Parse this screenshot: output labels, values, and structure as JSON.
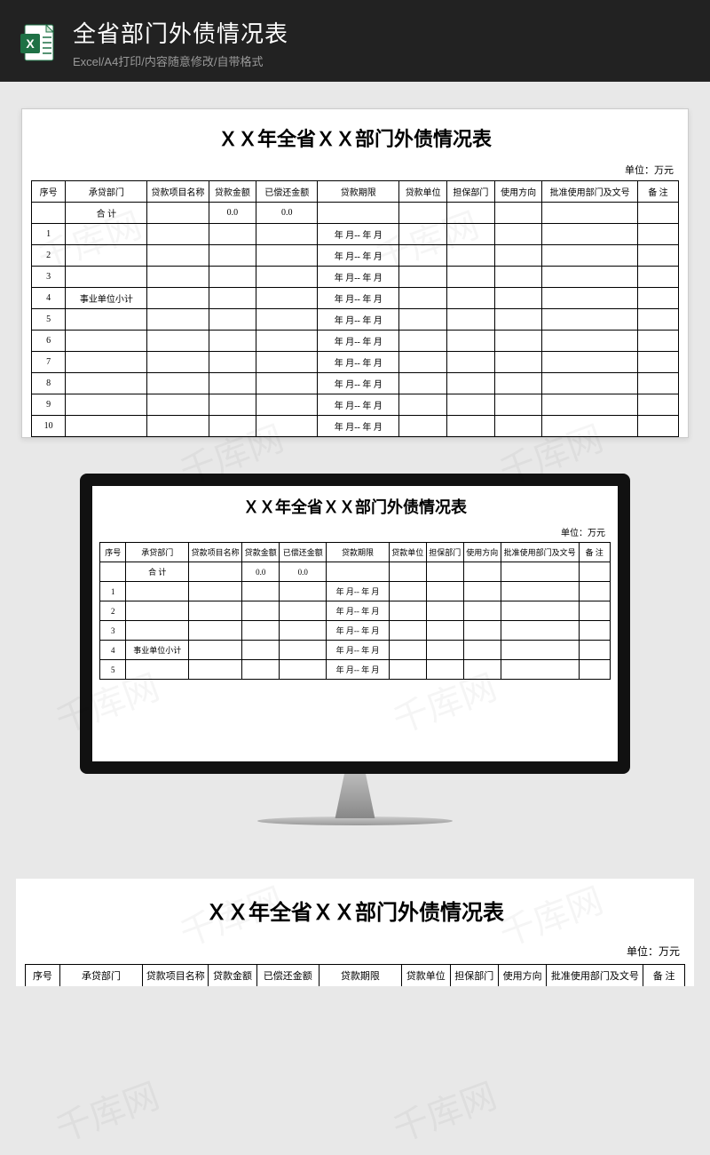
{
  "header": {
    "title": "全省部门外债情况表",
    "subtitle": "Excel/A4打印/内容随意修改/自带格式"
  },
  "sheet": {
    "title": "ＸＸ年全省ＸＸ部门外债情况表",
    "unit_label": "单位：万元",
    "columns": {
      "seq": "序号",
      "dept": "承贷部门",
      "project": "贷款项目名称",
      "amount": "贷款金额",
      "paid": "已偿还金额",
      "period": "贷款期限",
      "loan_unit": "贷款单位",
      "guarantee": "担保部门",
      "usage": "使用方向",
      "approval": "批准使用部门及文号",
      "note": "备  注"
    },
    "total_row": {
      "label": "合  计",
      "amount": "0.0",
      "paid": "0.0"
    },
    "period_text": "年 月--  年 月",
    "rows": [
      {
        "seq": "1",
        "dept": ""
      },
      {
        "seq": "2",
        "dept": ""
      },
      {
        "seq": "3",
        "dept": ""
      },
      {
        "seq": "4",
        "dept": "事业单位小计"
      },
      {
        "seq": "5",
        "dept": ""
      },
      {
        "seq": "6",
        "dept": ""
      },
      {
        "seq": "7",
        "dept": ""
      },
      {
        "seq": "8",
        "dept": ""
      },
      {
        "seq": "9",
        "dept": ""
      },
      {
        "seq": "10",
        "dept": ""
      }
    ],
    "monitor_row_count": 5
  },
  "watermark": "千库网"
}
